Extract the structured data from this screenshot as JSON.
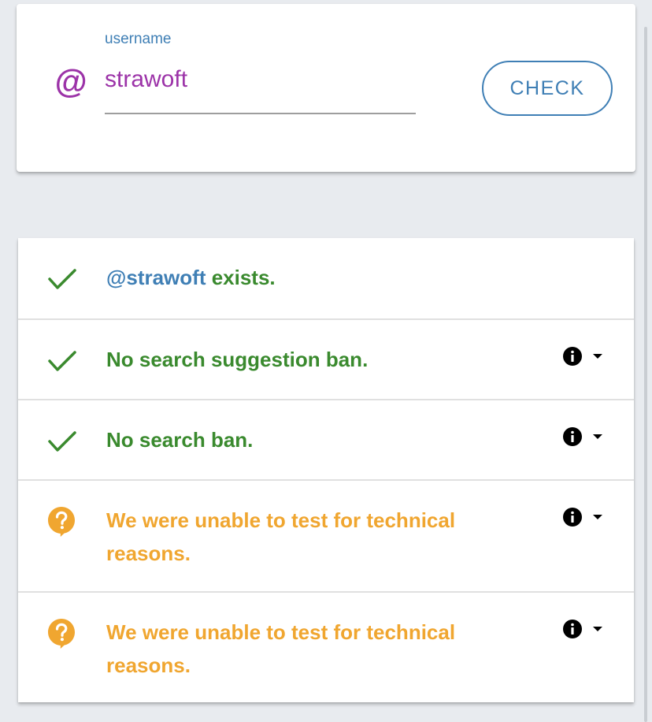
{
  "search": {
    "label": "username",
    "value": "strawoft",
    "at_symbol": "@",
    "button_label": "CHECK"
  },
  "results": [
    {
      "status": "pass",
      "icon": "check-icon",
      "handle": "@strawoft",
      "text": " exists.",
      "has_info": false
    },
    {
      "status": "pass",
      "icon": "check-icon",
      "text": "No search suggestion ban.",
      "has_info": true
    },
    {
      "status": "pass",
      "icon": "check-icon",
      "text": "No search ban.",
      "has_info": true
    },
    {
      "status": "unknown",
      "icon": "question-bubble-icon",
      "text": "We were unable to test for technical reasons.",
      "has_info": true
    },
    {
      "status": "unknown",
      "icon": "question-bubble-icon",
      "text": "We were unable to test for technical reasons.",
      "has_info": true
    }
  ],
  "colors": {
    "accent_purple": "#9c33a8",
    "accent_blue": "#3f7fb5",
    "success_green": "#3a8a2e",
    "warning_orange": "#f0a630",
    "background": "#e8ebef"
  }
}
